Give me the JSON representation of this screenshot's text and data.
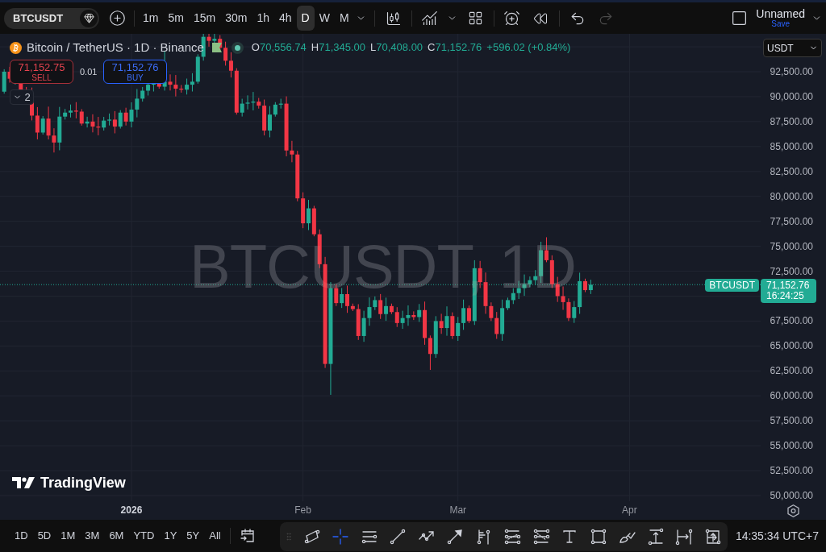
{
  "top_toolbar": {
    "symbol": "BTCUSDT",
    "intervals": [
      {
        "label": "1m",
        "selected": false
      },
      {
        "label": "5m",
        "selected": false
      },
      {
        "label": "15m",
        "selected": false
      },
      {
        "label": "30m",
        "selected": false
      },
      {
        "label": "1h",
        "selected": false
      },
      {
        "label": "4h",
        "selected": false
      },
      {
        "label": "D",
        "selected": true
      },
      {
        "label": "W",
        "selected": false
      },
      {
        "label": "M",
        "selected": false
      }
    ],
    "history": [
      {
        "kind": "undo",
        "disabled": false
      },
      {
        "kind": "redo",
        "disabled": true
      }
    ],
    "layout_name": "Unnamed",
    "save_label": "Save"
  },
  "legend": {
    "title": "Bitcoin / TetherUS · 1D · Binance",
    "ohlc": [
      {
        "key": "O",
        "value": "70,556.74"
      },
      {
        "key": "H",
        "value": "71,345.00"
      },
      {
        "key": "L",
        "value": "70,408.00"
      },
      {
        "key": "C",
        "value": "71,152.76"
      }
    ],
    "change": "+596.02 (+0.84%)",
    "indicator_count": "2"
  },
  "trade": {
    "sell": {
      "price": "71,152.75",
      "label": "SELL"
    },
    "quantity": "0.01",
    "buy": {
      "price": "71,152.76",
      "label": "BUY"
    }
  },
  "chart": {
    "watermark": "BTCUSDT, 1D",
    "logo": "TradingView",
    "price_tag": {
      "symbol": "BTCUSDT",
      "price": "71,152.76",
      "countdown": "16:24:25"
    }
  },
  "price_axis": {
    "currency": "USDT",
    "labels": [
      "92,500.00",
      "90,000.00",
      "87,500.00",
      "85,000.00",
      "82,500.00",
      "80,000.00",
      "77,500.00",
      "75,000.00",
      "72,500.00",
      "67,500.00",
      "65,000.00",
      "62,500.00",
      "60,000.00",
      "57,500.00",
      "55,000.00",
      "52,500.00",
      "50,000.00"
    ]
  },
  "time_axis": {
    "labels": [
      {
        "label": "2026",
        "kind": "year"
      },
      {
        "label": "Feb",
        "kind": "month"
      },
      {
        "label": "Mar",
        "kind": "month"
      },
      {
        "label": "Apr",
        "kind": "month"
      }
    ]
  },
  "bottom_toolbar": {
    "ranges": [
      "1D",
      "5D",
      "1M",
      "3M",
      "6M",
      "YTD",
      "1Y",
      "5Y",
      "All"
    ],
    "clock": "14:35:34 UTC+7"
  },
  "drawing_tools": [
    {
      "kind": "channel",
      "selected": false
    },
    {
      "kind": "crosshair",
      "selected": true
    },
    {
      "kind": "horizontal-lines",
      "selected": false
    },
    {
      "kind": "trend-line",
      "selected": false
    },
    {
      "kind": "path",
      "selected": false
    },
    {
      "kind": "arrow",
      "selected": false
    },
    {
      "kind": "pitchfork",
      "selected": false
    },
    {
      "kind": "fib-retracement",
      "selected": false
    },
    {
      "kind": "fib-extension",
      "selected": false
    },
    {
      "kind": "text",
      "selected": false
    },
    {
      "kind": "rectangle",
      "selected": false
    },
    {
      "kind": "brush",
      "selected": false
    },
    {
      "kind": "price-range",
      "selected": false
    },
    {
      "kind": "date-range",
      "selected": false
    },
    {
      "kind": "date-price-range",
      "selected": false
    }
  ]
}
